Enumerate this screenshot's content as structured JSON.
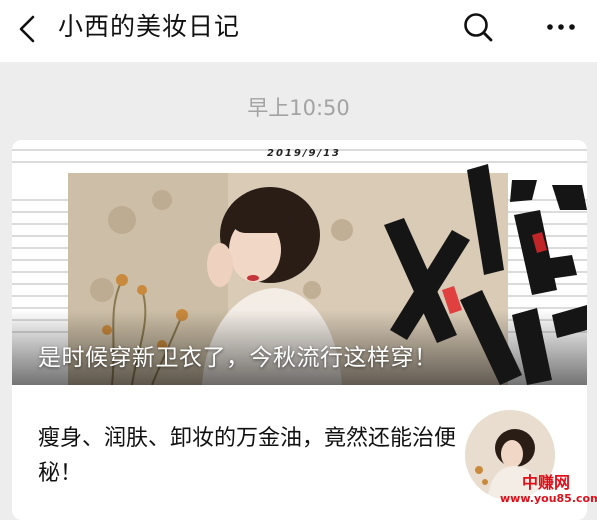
{
  "header": {
    "title": "小西的美妆日记"
  },
  "timestamp": "早上10:50",
  "article_main": {
    "cover_date": "2019/9/13",
    "cover_graphic_text": "XIA MZ",
    "title": "是时候穿新卫衣了，今秋流行这样穿！"
  },
  "article_second": {
    "title": "瘦身、润肤、卸妆的万金油，竟然还能治便秘！"
  },
  "watermark": {
    "line1": "中赚网",
    "line2": "www.you85.com"
  },
  "colors": {
    "background": "#ededed",
    "watermark": "#e0101a"
  },
  "icons": [
    "back-icon",
    "search-icon",
    "more-icon"
  ]
}
